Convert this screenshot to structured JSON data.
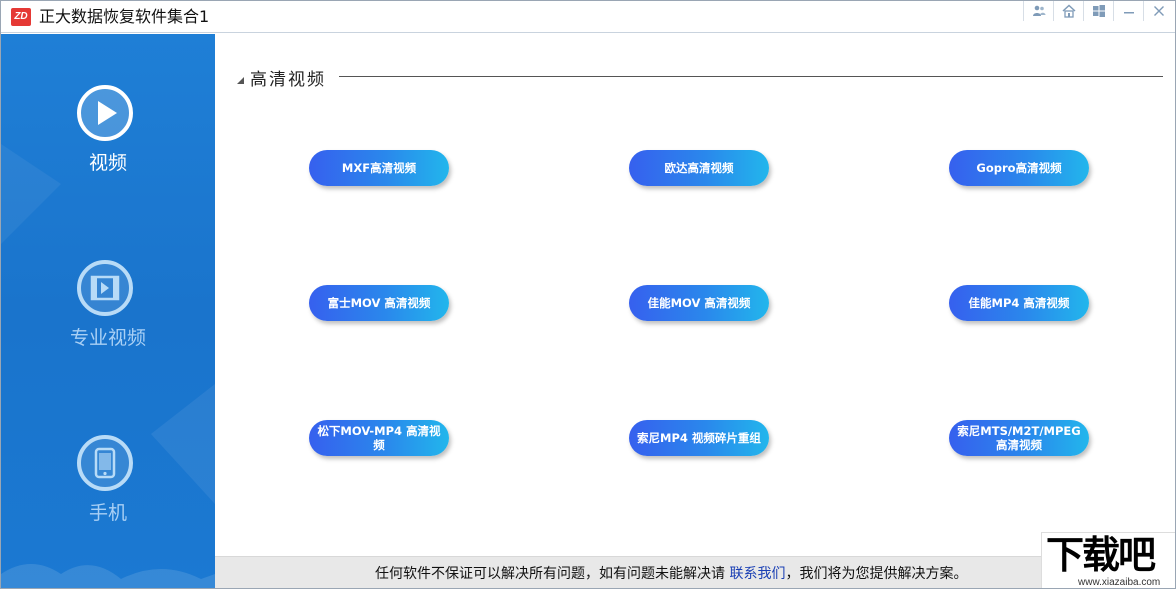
{
  "window": {
    "logo_text": "ZD",
    "title": "正大数据恢复软件集合1"
  },
  "window_controls": [
    "users-icon",
    "home-icon",
    "windows-icon",
    "minimize-icon",
    "close-icon"
  ],
  "sidebar": {
    "items": [
      {
        "label": "视频",
        "icon": "play-icon",
        "active": true
      },
      {
        "label": "专业视频",
        "icon": "film-icon",
        "active": false
      },
      {
        "label": "手机",
        "icon": "phone-icon",
        "active": false
      }
    ]
  },
  "main": {
    "section_title": "高清视频",
    "buttons": [
      {
        "label": "MXF高清视频"
      },
      {
        "label": "欧达高清视频"
      },
      {
        "label": "Gopro高清视频"
      },
      {
        "label": "富士MOV 高清视频"
      },
      {
        "label": "佳能MOV 高清视频"
      },
      {
        "label": "佳能MP4 高清视频"
      },
      {
        "label": "松下MOV-MP4 高清视频"
      },
      {
        "label": "索尼MP4 视频碎片重组"
      },
      {
        "label": "索尼MTS/M2T/MPEG\n高清视频"
      }
    ]
  },
  "footer": {
    "text_before": "任何软件不保证可以解决所有问题，如有问题未能解决请 ",
    "link": "联系我们",
    "text_after": "，我们将为您提供解决方案。"
  },
  "watermark": {
    "main": "下载吧",
    "sub": "www.xiazaiba.com"
  },
  "colors": {
    "sidebar_blue": "#1a74cc",
    "button_start": "#3660ee",
    "button_end": "#22b6ec",
    "link_blue": "#1a3fb4",
    "logo_red": "#e53935"
  }
}
